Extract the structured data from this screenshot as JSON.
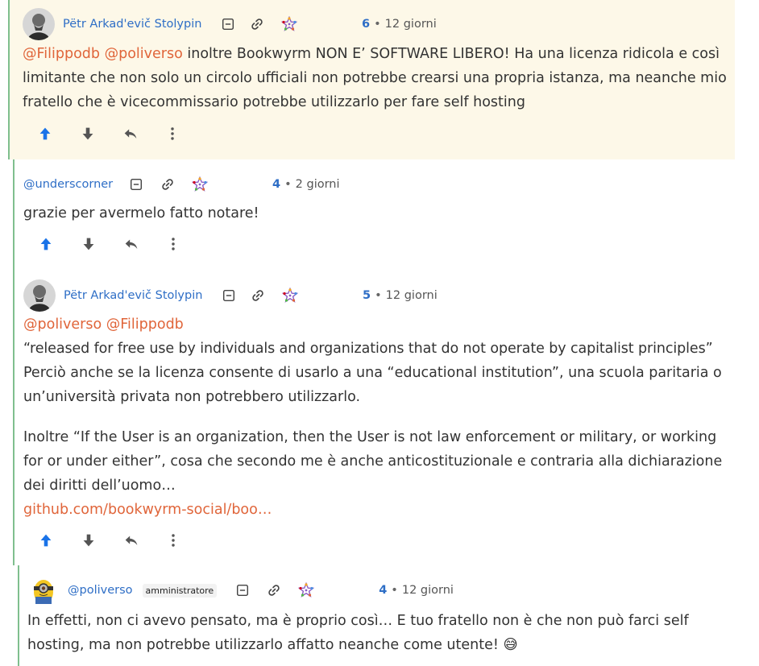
{
  "comments": [
    {
      "author": "Pëtr Arkad'evič Stolypin",
      "score": "6",
      "separator": "•",
      "age": "12 giorni",
      "mentions": [
        "@Filippodb",
        "@poliverso"
      ],
      "text": " inoltre Bookwyrm NON E’ SOFTWARE LIBERO! Ha una licenza ridicola e così limitante che non solo un circolo ufficiali non potrebbe crearsi una propria istanza, ma neanche mio fratello che è vicecommissario potrebbe utilizzarlo per fare self hosting"
    },
    {
      "author": "@underscorner",
      "score": "4",
      "separator": "•",
      "age": "2 giorni",
      "text": "grazie per avermelo fatto notare!"
    },
    {
      "author": "Pëtr Arkad'evič Stolypin",
      "score": "5",
      "separator": "•",
      "age": "12 giorni",
      "mentions": [
        "@poliverso",
        "@Filippodb"
      ],
      "paragraph1_line1": "“released for free use by individuals and organizations that do not operate by capitalist principles”",
      "paragraph1_rest": "Perciò anche se la licenza consente di usarlo a una “educational institution”, una scuola paritaria o un’università privata non potrebbero utilizzarlo.",
      "paragraph2": "Inoltre “If the User is an organization, then the User is not law enforcement or military, or working for or under either”, cosa che secondo me è anche anticostituzionale e contraria alla dichiarazione dei diritti dell’uomo…",
      "link": "github.com/bookwyrm-social/boo…"
    },
    {
      "author": "@poliverso",
      "role": "amministratore",
      "score": "4",
      "separator": "•",
      "age": "12 giorni",
      "text": "In effetti, non ci avevo pensato, ma è proprio così… E tuo fratello non è che non può farci self hosting, ma non potrebbe utilizzarlo affatto neanche come utente!",
      "emoji": "😅"
    }
  ],
  "colors": {
    "accent": "#2e6ec6",
    "mention": "#e0653a",
    "highlight_bg": "#fdf8e8",
    "thread_line": "#7fbf8e",
    "upvote": "#1a73e8"
  }
}
